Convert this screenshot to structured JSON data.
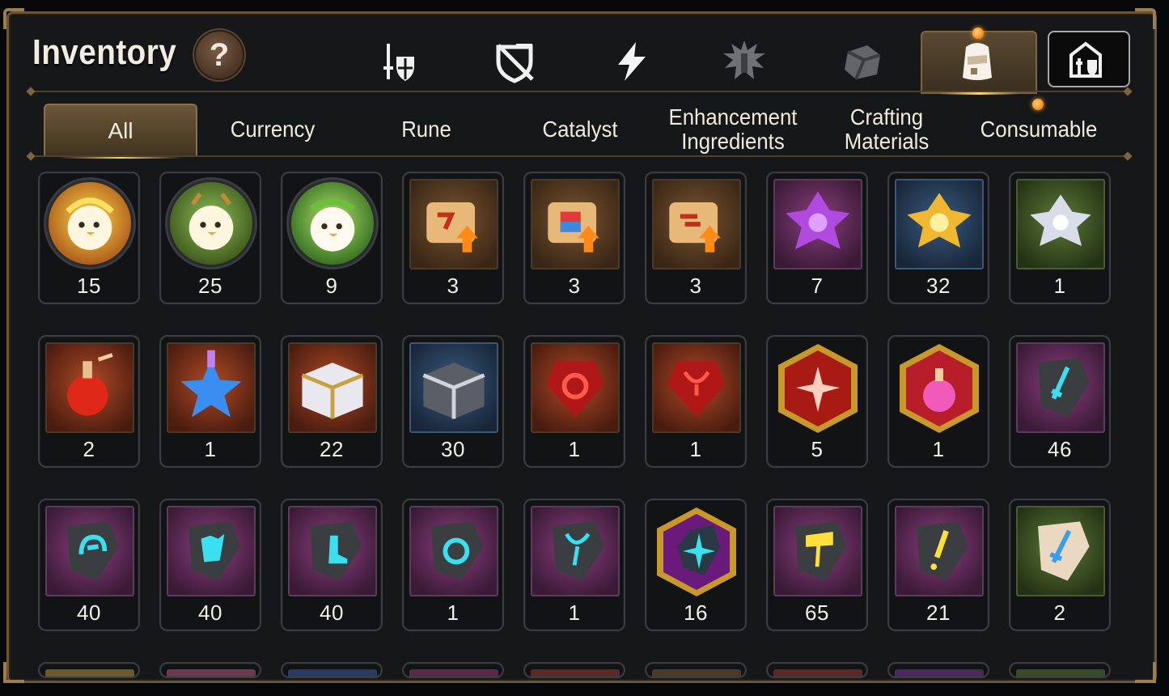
{
  "header": {
    "title": "Inventory",
    "help_symbol": "?"
  },
  "category_icons": [
    {
      "name": "equipment-sword-shield-icon",
      "selected": false
    },
    {
      "name": "no-equipment-shield-icon",
      "selected": false
    },
    {
      "name": "lightning-icon",
      "selected": false
    },
    {
      "name": "splash-emblem-icon",
      "selected": false
    },
    {
      "name": "cube-icon",
      "selected": false
    },
    {
      "name": "backpack-icon",
      "selected": true
    },
    {
      "name": "guild-castle-icon",
      "selected": false
    }
  ],
  "tabs": [
    {
      "label": "All",
      "active": true
    },
    {
      "label": "Currency",
      "active": false
    },
    {
      "label": "Rune",
      "active": false
    },
    {
      "label": "Catalyst",
      "active": false
    },
    {
      "label": "Enhancement Ingredients",
      "active": false
    },
    {
      "label": "Crafting Materials",
      "active": false
    },
    {
      "label": "Consumable",
      "active": false
    }
  ],
  "items": [
    [
      {
        "name": "yellow-chick-avatar",
        "qty": "15"
      },
      {
        "name": "deer-chick-avatar",
        "qty": "25"
      },
      {
        "name": "laurel-chick-avatar",
        "qty": "9"
      },
      {
        "name": "scroll-upgrade-red",
        "qty": "3"
      },
      {
        "name": "scroll-upgrade-rainbow",
        "qty": "3"
      },
      {
        "name": "scroll-upgrade-orange",
        "qty": "3"
      },
      {
        "name": "purple-crystal-flower",
        "qty": "7"
      },
      {
        "name": "gold-crystal-flower",
        "qty": "32"
      },
      {
        "name": "silver-crystal-flower",
        "qty": "1"
      }
    ],
    [
      {
        "name": "red-potion",
        "qty": "2"
      },
      {
        "name": "blue-star",
        "qty": "1"
      },
      {
        "name": "gold-chest",
        "qty": "22"
      },
      {
        "name": "silver-chest",
        "qty": "30"
      },
      {
        "name": "red-gem-ring",
        "qty": "1"
      },
      {
        "name": "red-gem-necklace",
        "qty": "1"
      },
      {
        "name": "red-star-hexagon",
        "qty": "5"
      },
      {
        "name": "pink-potion-hexagon",
        "qty": "1"
      },
      {
        "name": "stone-sword",
        "qty": "46"
      }
    ],
    [
      {
        "name": "stone-helmet",
        "qty": "40"
      },
      {
        "name": "stone-armor",
        "qty": "40"
      },
      {
        "name": "stone-boots",
        "qty": "40"
      },
      {
        "name": "stone-ring",
        "qty": "1"
      },
      {
        "name": "stone-necklace",
        "qty": "1"
      },
      {
        "name": "purple-star-hexagon",
        "qty": "16"
      },
      {
        "name": "stone-hammer",
        "qty": "65"
      },
      {
        "name": "stone-exclamation",
        "qty": "21"
      },
      {
        "name": "light-stone-sword",
        "qty": "2"
      }
    ]
  ],
  "colors": {
    "accent_gold": "#c8a060",
    "panel_bg": "#161718",
    "slot_border": "#3c3d40",
    "notification": "#f08a10"
  }
}
